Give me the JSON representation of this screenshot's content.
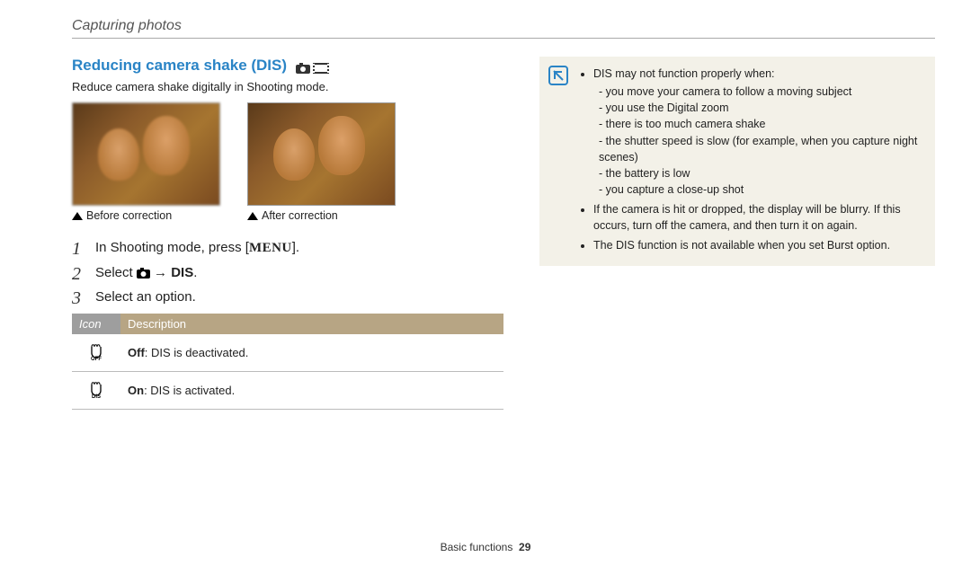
{
  "header": {
    "breadcrumb": "Capturing photos"
  },
  "section": {
    "title": "Reducing camera shake (DIS)",
    "intro": "Reduce camera shake digitally in Shooting mode.",
    "title_icons": [
      "camera-mode-icon",
      "film-mode-icon"
    ]
  },
  "captions": {
    "before": "Before correction",
    "after": "After correction"
  },
  "steps": {
    "s1_a": "In Shooting mode, press [",
    "s1_menu": "MENU",
    "s1_b": "].",
    "s2_a": "Select ",
    "s2_arrow": " → ",
    "s2_dis": "DIS",
    "s2_b": ".",
    "s3": "Select an option."
  },
  "table": {
    "head_icon": "Icon",
    "head_desc": "Description",
    "rows": [
      {
        "icon": "dis-off-icon",
        "label_bold": "Off",
        "label_rest": ": DIS is deactivated."
      },
      {
        "icon": "dis-on-icon",
        "label_bold": "On",
        "label_rest": ": DIS is activated."
      }
    ]
  },
  "note": {
    "lead": "DIS may not function properly when:",
    "sub": [
      "you move your camera to follow a moving subject",
      "you use the Digital zoom",
      "there is too much camera shake",
      "the shutter speed is slow (for example, when you capture night scenes)",
      "the battery is low",
      "you capture a close-up shot"
    ],
    "b2": "If the camera is hit or dropped, the display will be blurry. If this occurs, turn off the camera, and then turn it on again.",
    "b3": "The DIS function is not available when you set Burst option."
  },
  "footer": {
    "section": "Basic functions",
    "page": "29"
  }
}
